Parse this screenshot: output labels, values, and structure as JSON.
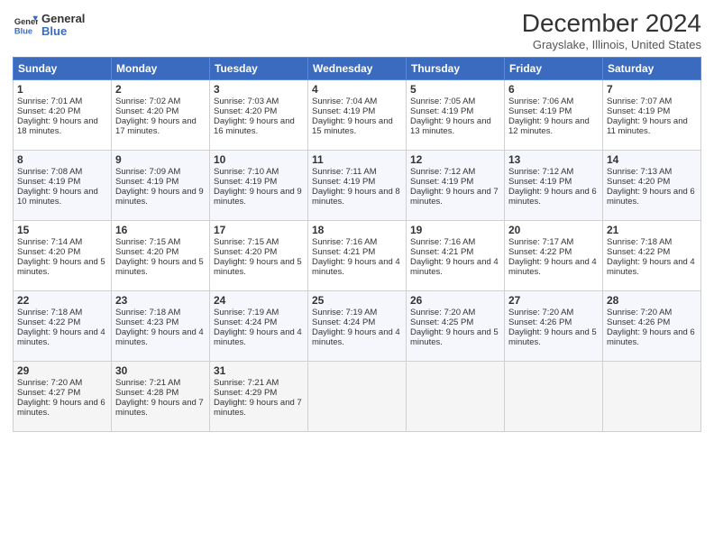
{
  "header": {
    "logo_line1": "General",
    "logo_line2": "Blue",
    "title": "December 2024",
    "location": "Grayslake, Illinois, United States"
  },
  "days_of_week": [
    "Sunday",
    "Monday",
    "Tuesday",
    "Wednesday",
    "Thursday",
    "Friday",
    "Saturday"
  ],
  "weeks": [
    [
      {
        "day": "1",
        "sunrise": "Sunrise: 7:01 AM",
        "sunset": "Sunset: 4:20 PM",
        "daylight": "Daylight: 9 hours and 18 minutes."
      },
      {
        "day": "2",
        "sunrise": "Sunrise: 7:02 AM",
        "sunset": "Sunset: 4:20 PM",
        "daylight": "Daylight: 9 hours and 17 minutes."
      },
      {
        "day": "3",
        "sunrise": "Sunrise: 7:03 AM",
        "sunset": "Sunset: 4:20 PM",
        "daylight": "Daylight: 9 hours and 16 minutes."
      },
      {
        "day": "4",
        "sunrise": "Sunrise: 7:04 AM",
        "sunset": "Sunset: 4:19 PM",
        "daylight": "Daylight: 9 hours and 15 minutes."
      },
      {
        "day": "5",
        "sunrise": "Sunrise: 7:05 AM",
        "sunset": "Sunset: 4:19 PM",
        "daylight": "Daylight: 9 hours and 13 minutes."
      },
      {
        "day": "6",
        "sunrise": "Sunrise: 7:06 AM",
        "sunset": "Sunset: 4:19 PM",
        "daylight": "Daylight: 9 hours and 12 minutes."
      },
      {
        "day": "7",
        "sunrise": "Sunrise: 7:07 AM",
        "sunset": "Sunset: 4:19 PM",
        "daylight": "Daylight: 9 hours and 11 minutes."
      }
    ],
    [
      {
        "day": "8",
        "sunrise": "Sunrise: 7:08 AM",
        "sunset": "Sunset: 4:19 PM",
        "daylight": "Daylight: 9 hours and 10 minutes."
      },
      {
        "day": "9",
        "sunrise": "Sunrise: 7:09 AM",
        "sunset": "Sunset: 4:19 PM",
        "daylight": "Daylight: 9 hours and 9 minutes."
      },
      {
        "day": "10",
        "sunrise": "Sunrise: 7:10 AM",
        "sunset": "Sunset: 4:19 PM",
        "daylight": "Daylight: 9 hours and 9 minutes."
      },
      {
        "day": "11",
        "sunrise": "Sunrise: 7:11 AM",
        "sunset": "Sunset: 4:19 PM",
        "daylight": "Daylight: 9 hours and 8 minutes."
      },
      {
        "day": "12",
        "sunrise": "Sunrise: 7:12 AM",
        "sunset": "Sunset: 4:19 PM",
        "daylight": "Daylight: 9 hours and 7 minutes."
      },
      {
        "day": "13",
        "sunrise": "Sunrise: 7:12 AM",
        "sunset": "Sunset: 4:19 PM",
        "daylight": "Daylight: 9 hours and 6 minutes."
      },
      {
        "day": "14",
        "sunrise": "Sunrise: 7:13 AM",
        "sunset": "Sunset: 4:20 PM",
        "daylight": "Daylight: 9 hours and 6 minutes."
      }
    ],
    [
      {
        "day": "15",
        "sunrise": "Sunrise: 7:14 AM",
        "sunset": "Sunset: 4:20 PM",
        "daylight": "Daylight: 9 hours and 5 minutes."
      },
      {
        "day": "16",
        "sunrise": "Sunrise: 7:15 AM",
        "sunset": "Sunset: 4:20 PM",
        "daylight": "Daylight: 9 hours and 5 minutes."
      },
      {
        "day": "17",
        "sunrise": "Sunrise: 7:15 AM",
        "sunset": "Sunset: 4:20 PM",
        "daylight": "Daylight: 9 hours and 5 minutes."
      },
      {
        "day": "18",
        "sunrise": "Sunrise: 7:16 AM",
        "sunset": "Sunset: 4:21 PM",
        "daylight": "Daylight: 9 hours and 4 minutes."
      },
      {
        "day": "19",
        "sunrise": "Sunrise: 7:16 AM",
        "sunset": "Sunset: 4:21 PM",
        "daylight": "Daylight: 9 hours and 4 minutes."
      },
      {
        "day": "20",
        "sunrise": "Sunrise: 7:17 AM",
        "sunset": "Sunset: 4:22 PM",
        "daylight": "Daylight: 9 hours and 4 minutes."
      },
      {
        "day": "21",
        "sunrise": "Sunrise: 7:18 AM",
        "sunset": "Sunset: 4:22 PM",
        "daylight": "Daylight: 9 hours and 4 minutes."
      }
    ],
    [
      {
        "day": "22",
        "sunrise": "Sunrise: 7:18 AM",
        "sunset": "Sunset: 4:22 PM",
        "daylight": "Daylight: 9 hours and 4 minutes."
      },
      {
        "day": "23",
        "sunrise": "Sunrise: 7:18 AM",
        "sunset": "Sunset: 4:23 PM",
        "daylight": "Daylight: 9 hours and 4 minutes."
      },
      {
        "day": "24",
        "sunrise": "Sunrise: 7:19 AM",
        "sunset": "Sunset: 4:24 PM",
        "daylight": "Daylight: 9 hours and 4 minutes."
      },
      {
        "day": "25",
        "sunrise": "Sunrise: 7:19 AM",
        "sunset": "Sunset: 4:24 PM",
        "daylight": "Daylight: 9 hours and 4 minutes."
      },
      {
        "day": "26",
        "sunrise": "Sunrise: 7:20 AM",
        "sunset": "Sunset: 4:25 PM",
        "daylight": "Daylight: 9 hours and 5 minutes."
      },
      {
        "day": "27",
        "sunrise": "Sunrise: 7:20 AM",
        "sunset": "Sunset: 4:26 PM",
        "daylight": "Daylight: 9 hours and 5 minutes."
      },
      {
        "day": "28",
        "sunrise": "Sunrise: 7:20 AM",
        "sunset": "Sunset: 4:26 PM",
        "daylight": "Daylight: 9 hours and 6 minutes."
      }
    ],
    [
      {
        "day": "29",
        "sunrise": "Sunrise: 7:20 AM",
        "sunset": "Sunset: 4:27 PM",
        "daylight": "Daylight: 9 hours and 6 minutes."
      },
      {
        "day": "30",
        "sunrise": "Sunrise: 7:21 AM",
        "sunset": "Sunset: 4:28 PM",
        "daylight": "Daylight: 9 hours and 7 minutes."
      },
      {
        "day": "31",
        "sunrise": "Sunrise: 7:21 AM",
        "sunset": "Sunset: 4:29 PM",
        "daylight": "Daylight: 9 hours and 7 minutes."
      },
      null,
      null,
      null,
      null
    ]
  ]
}
